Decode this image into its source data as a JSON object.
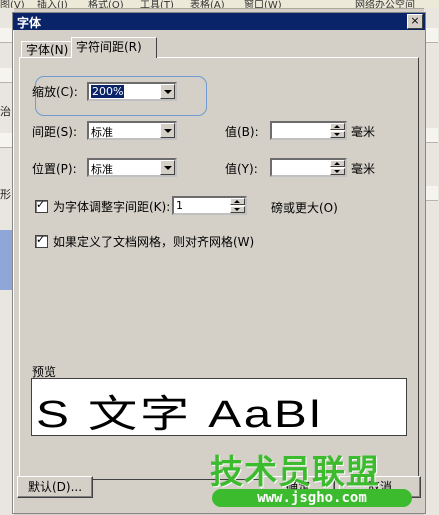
{
  "background": {
    "menu_items": [
      "图(V)",
      "插入(I)",
      "格式(O)",
      "工具(T)",
      "表格(A)",
      "窗口(W)",
      "网络办公空间"
    ],
    "left_fragments": [
      "治",
      "形"
    ]
  },
  "dialog": {
    "title": "字体",
    "close_glyph": "×",
    "tabs": [
      "字体(N)",
      "字符间距(R)"
    ],
    "scale": {
      "label": "缩放(C):",
      "value": "200%"
    },
    "spacing": {
      "label": "间距(S):",
      "value": "标准",
      "by_label": "值(B):",
      "by_value": "",
      "unit": "毫米"
    },
    "position": {
      "label": "位置(P):",
      "value": "标准",
      "by_label": "值(Y):",
      "by_value": "",
      "unit": "毫米"
    },
    "kerning": {
      "label": "为字体调整字间距(K):",
      "value": "1",
      "suffix": "磅或更大(O)",
      "checked": true
    },
    "grid": {
      "label": "如果定义了文档网格，则对齐网格(W)",
      "checked": true
    },
    "preview": {
      "label": "预览",
      "text": "S 文字 AaBl"
    },
    "buttons": {
      "default": "默认(D)...",
      "ok": "确定",
      "cancel": "取消"
    }
  },
  "watermark": {
    "title": "技术员联盟",
    "url": "www.jsgho.com"
  },
  "colors": {
    "titlebar": "#0a246a",
    "face": "#d4d0c8",
    "highlight": "#6f9bd1",
    "watermark": "#3dbb2f"
  }
}
